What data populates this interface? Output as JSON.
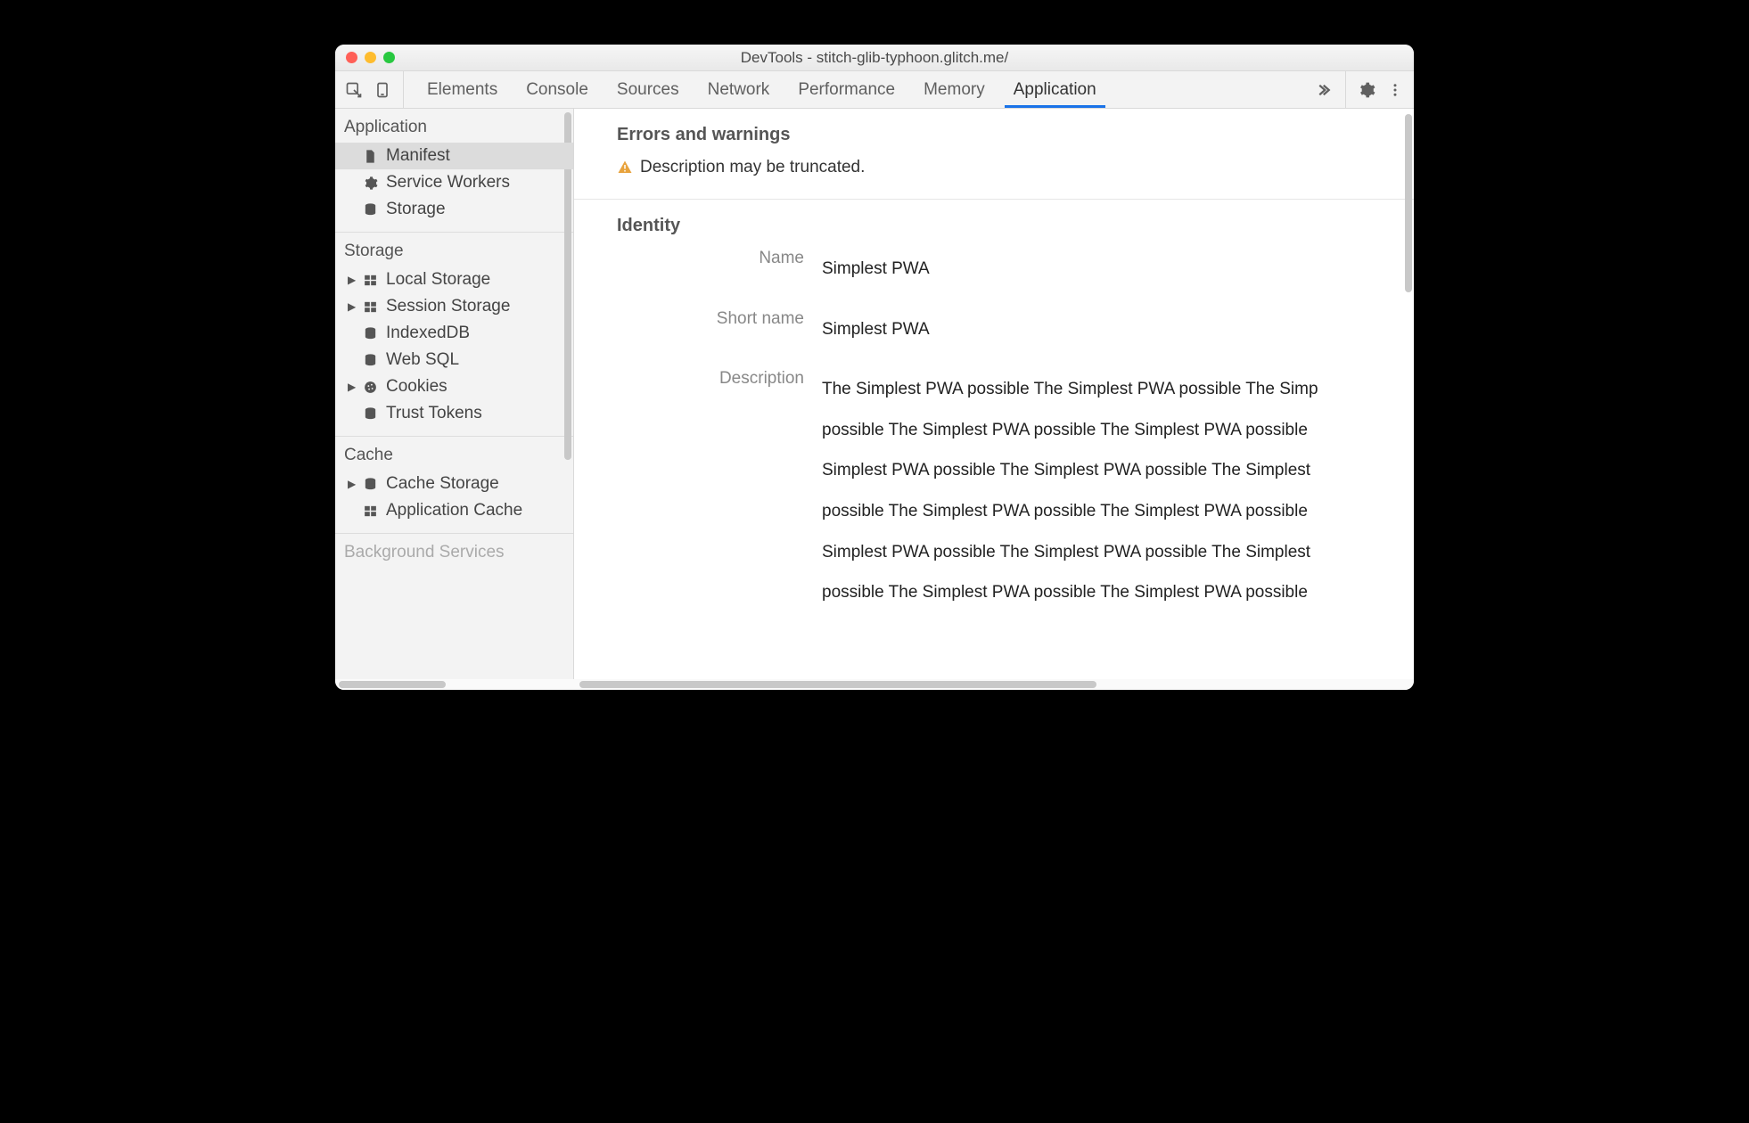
{
  "window": {
    "title": "DevTools - stitch-glib-typhoon.glitch.me/"
  },
  "toolbar": {
    "tabs": [
      "Elements",
      "Console",
      "Sources",
      "Network",
      "Performance",
      "Memory",
      "Application"
    ],
    "active": "Application"
  },
  "sidebar": {
    "sections": [
      {
        "title": "Application",
        "items": [
          {
            "label": "Manifest",
            "icon": "file",
            "selected": true
          },
          {
            "label": "Service Workers",
            "icon": "gear"
          },
          {
            "label": "Storage",
            "icon": "db"
          }
        ]
      },
      {
        "title": "Storage",
        "items": [
          {
            "label": "Local Storage",
            "icon": "grid",
            "expandable": true
          },
          {
            "label": "Session Storage",
            "icon": "grid",
            "expandable": true
          },
          {
            "label": "IndexedDB",
            "icon": "db"
          },
          {
            "label": "Web SQL",
            "icon": "db"
          },
          {
            "label": "Cookies",
            "icon": "cookie",
            "expandable": true
          },
          {
            "label": "Trust Tokens",
            "icon": "db"
          }
        ]
      },
      {
        "title": "Cache",
        "items": [
          {
            "label": "Cache Storage",
            "icon": "db",
            "expandable": true
          },
          {
            "label": "Application Cache",
            "icon": "grid"
          }
        ]
      }
    ],
    "truncated_section": "Background Services"
  },
  "main": {
    "errors_section": {
      "title": "Errors and warnings",
      "warning": "Description may be truncated."
    },
    "identity_section": {
      "title": "Identity",
      "name_label": "Name",
      "name_value": "Simplest PWA",
      "short_name_label": "Short name",
      "short_name_value": "Simplest PWA",
      "description_label": "Description",
      "description_value": "The Simplest PWA possible The Simplest PWA possible The Simp possible The Simplest PWA possible The Simplest PWA possible ​ Simplest PWA possible The Simplest PWA possible The Simplest possible The Simplest PWA possible The Simplest PWA possible ​ Simplest PWA possible The Simplest PWA possible The Simplest possible The Simplest PWA possible The Simplest PWA possible"
    }
  }
}
